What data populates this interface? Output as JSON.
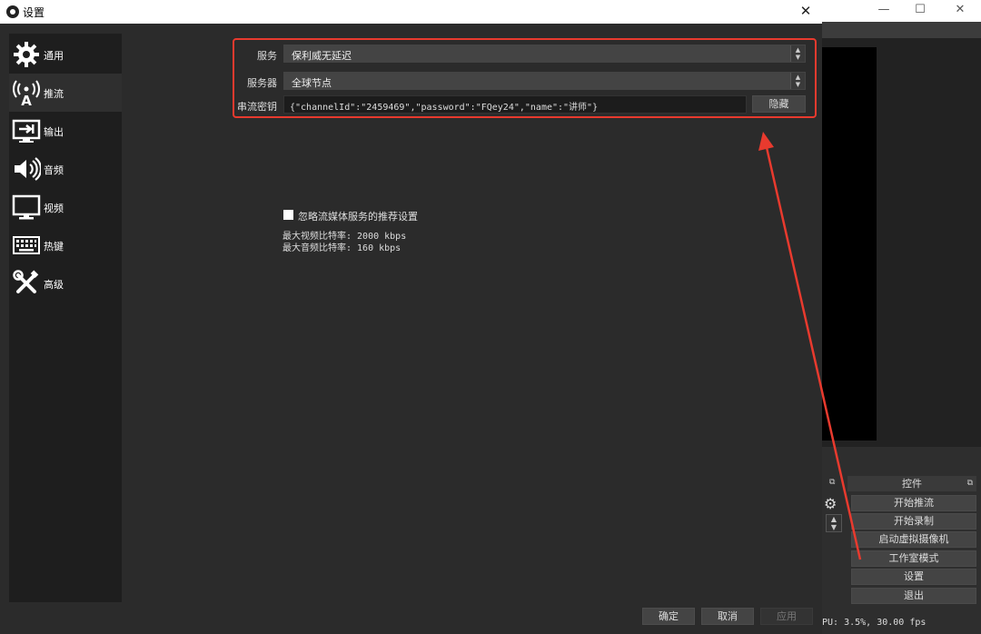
{
  "dialog": {
    "title": "设置",
    "close_glyph": "✕",
    "nav": [
      {
        "label": "通用",
        "icon": "gear-icon",
        "glyph": "⚙"
      },
      {
        "label": "推流",
        "icon": "broadcast-icon",
        "glyph": "A"
      },
      {
        "label": "输出",
        "icon": "output-icon",
        "glyph": "⇥"
      },
      {
        "label": "音频",
        "icon": "speaker-icon",
        "glyph": "🔊"
      },
      {
        "label": "视频",
        "icon": "monitor-icon",
        "glyph": "🖵"
      },
      {
        "label": "热键",
        "icon": "keyboard-icon",
        "glyph": "⌨"
      },
      {
        "label": "高级",
        "icon": "tools-icon",
        "glyph": "✂"
      }
    ],
    "active_nav": 1,
    "stream": {
      "service_label": "服务",
      "service_value": "保利威无延迟",
      "server_label": "服务器",
      "server_value": "全球节点",
      "key_label": "串流密钥",
      "key_value": "{\"channelId\":\"2459469\",\"password\":\"FQey24\",\"name\":\"讲师\"}",
      "hide_button": "隐藏"
    },
    "ignore_checkbox_label": "忽略流媒体服务的推荐设置",
    "ignore_checked": false,
    "max_video_bitrate": "最大视频比特率: 2000 kbps",
    "max_audio_bitrate": "最大音频比特率: 160 kbps",
    "buttons": {
      "ok": "确定",
      "cancel": "取消",
      "apply": "应用"
    }
  },
  "main_window": {
    "window_controls": {
      "minimize": "—",
      "maximize": "☐",
      "close": "✕"
    },
    "controls_dock_title": "控件",
    "controls": [
      "开始推流",
      "开始录制",
      "启动虚拟摄像机",
      "工作室模式",
      "设置",
      "退出"
    ],
    "status_text": "PU: 3.5%, 30.00 fps"
  },
  "colors": {
    "annotation": "#e83a2e",
    "background": "#2b2b2b",
    "sidebar": "#1e1e1e"
  }
}
